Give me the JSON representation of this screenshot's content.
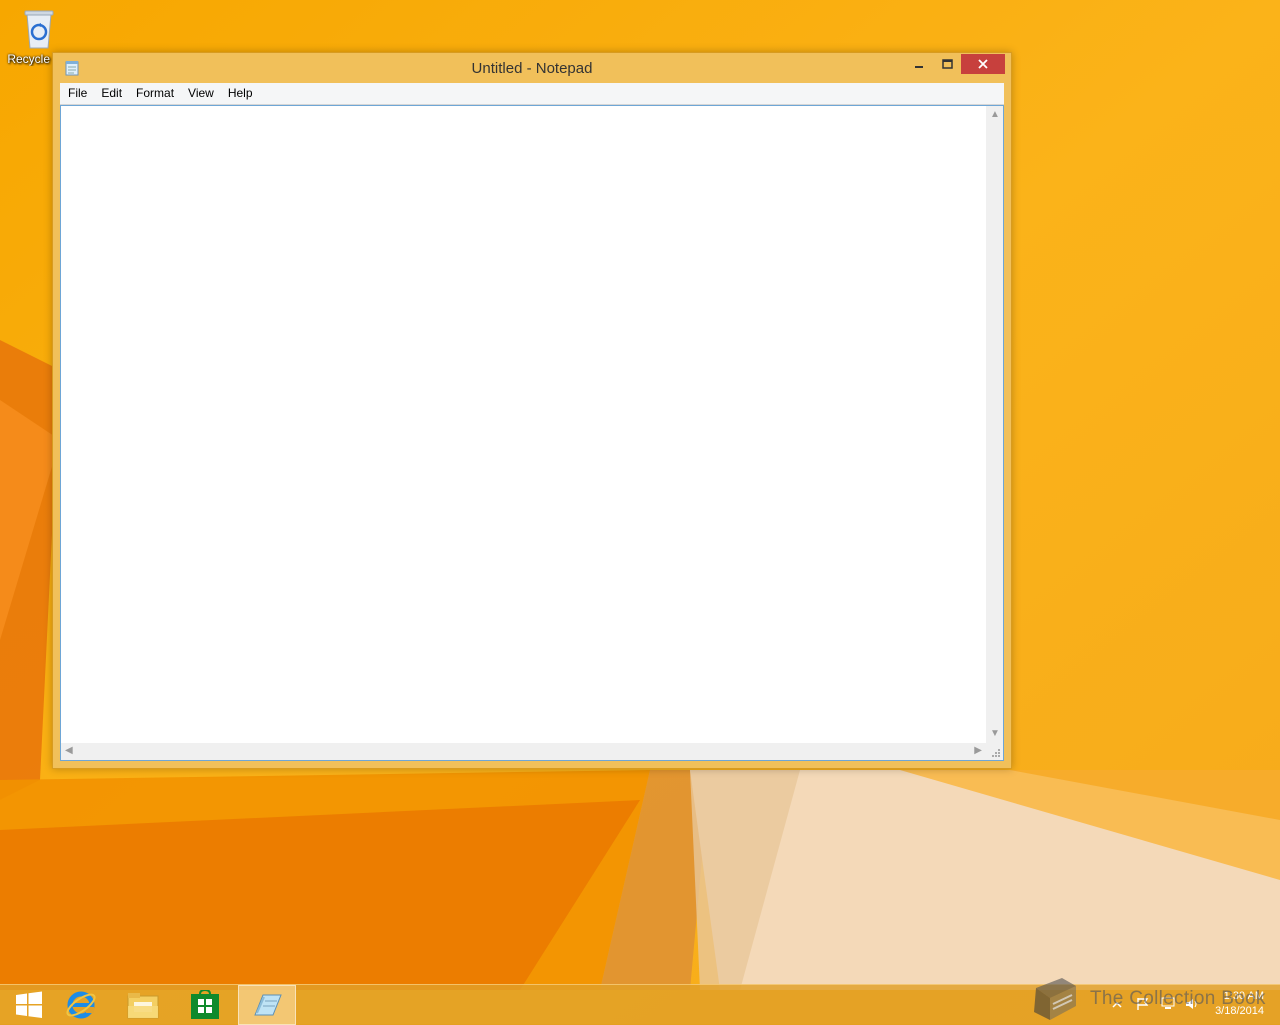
{
  "desktop": {
    "icons": [
      {
        "label": "Recycle Bin"
      }
    ]
  },
  "window": {
    "title": "Untitled - Notepad",
    "menu": [
      "File",
      "Edit",
      "Format",
      "View",
      "Help"
    ],
    "content": ""
  },
  "taskbar": {
    "pinned": [
      "start-icon",
      "internet-explorer-icon",
      "file-explorer-icon",
      "store-icon",
      "notepad-icon"
    ],
    "clock_time": "1:30 AM",
    "clock_date": "3/18/2014"
  },
  "watermark": {
    "text": "The Collection Book"
  },
  "colors": {
    "accent": "#f1c05a",
    "close": "#c7403d",
    "desktop": "#f5a300"
  }
}
